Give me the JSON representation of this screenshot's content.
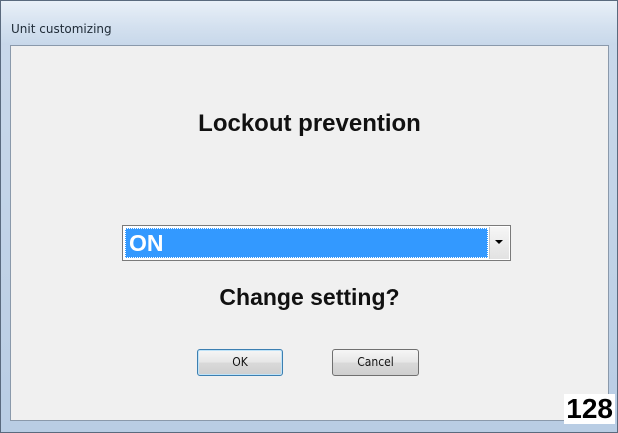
{
  "window": {
    "title": "Unit customizing"
  },
  "dialog": {
    "heading": "Lockout prevention",
    "combo": {
      "selected_value": "ON",
      "arrow_icon": "chevron-down-icon"
    },
    "question": "Change setting?",
    "buttons": {
      "ok_label": "OK",
      "cancel_label": "Cancel"
    }
  },
  "page_number": "128",
  "colors": {
    "selection_highlight": "#3399ff",
    "client_background": "#f0f0f0",
    "frame_background": "#c9d8ea"
  }
}
